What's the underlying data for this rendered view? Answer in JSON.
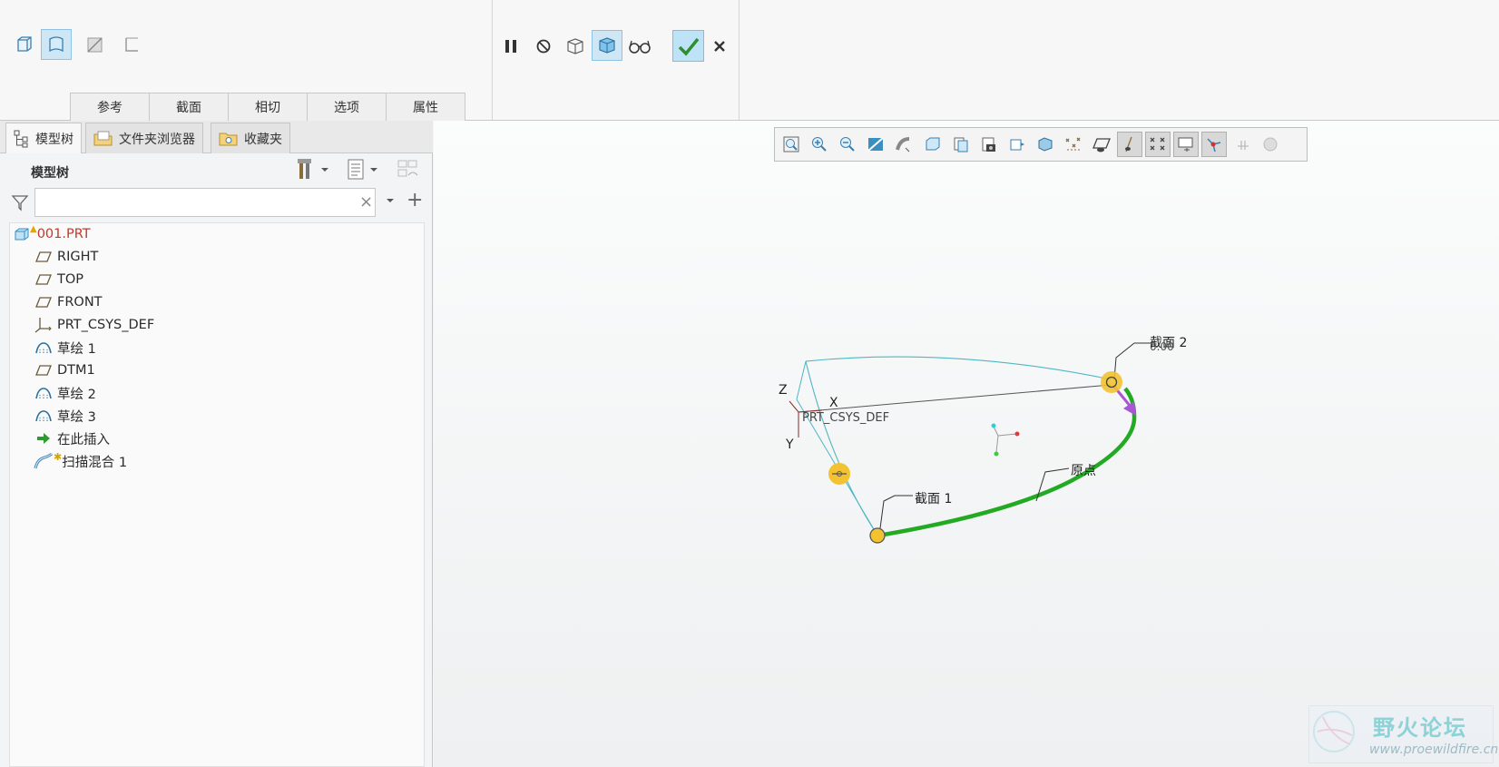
{
  "ribbon": {
    "tabs": [
      "参考",
      "截面",
      "相切",
      "选项",
      "属性"
    ],
    "icons_left": [
      "solid-icon",
      "surface-icon",
      "thin-icon",
      "remove-material-icon"
    ],
    "icons_right": [
      "pause-icon",
      "no-preview-icon",
      "verify-mode-icon",
      "geometry-preview-icon",
      "glasses-icon",
      "ok-check-icon",
      "cancel-x-icon"
    ],
    "accent": "#4aa3df",
    "check_color": "#2f8f2f"
  },
  "nav": {
    "tabs": [
      "模型树",
      "文件夹浏览器",
      "收藏夹"
    ],
    "tree_title": "模型树",
    "search_value": "",
    "search_clear": "×",
    "add_glyph": "+"
  },
  "tree": {
    "items": [
      {
        "label": "001.PRT",
        "icon": "part-icon"
      },
      {
        "label": "RIGHT",
        "icon": "datum-plane-icon"
      },
      {
        "label": "TOP",
        "icon": "datum-plane-icon"
      },
      {
        "label": "FRONT",
        "icon": "datum-plane-icon"
      },
      {
        "label": "PRT_CSYS_DEF",
        "icon": "csys-icon"
      },
      {
        "label": "草绘 1",
        "icon": "sketch-icon"
      },
      {
        "label": "DTM1",
        "icon": "datum-plane-icon"
      },
      {
        "label": "草绘 2",
        "icon": "sketch-icon"
      },
      {
        "label": "草绘 3",
        "icon": "sketch-icon"
      },
      {
        "label": "在此插入",
        "icon": "insert-arrow-icon"
      },
      {
        "label": "扫描混合 1",
        "icon": "sweep-blend-icon"
      }
    ]
  },
  "graphics": {
    "section2_label": "截面 2",
    "section2_value": "0.00",
    "section1_label": "截面 1",
    "origin_label": "原点",
    "csys_label": "PRT_CSYS_DEF",
    "axis_x": "X",
    "axis_y": "Y",
    "axis_z": "Z",
    "trajectory_color": "#22aa22",
    "handle_color": "#f2c230"
  },
  "watermark": {
    "title": "野火论坛",
    "url": "www.proewildfire.cn"
  }
}
